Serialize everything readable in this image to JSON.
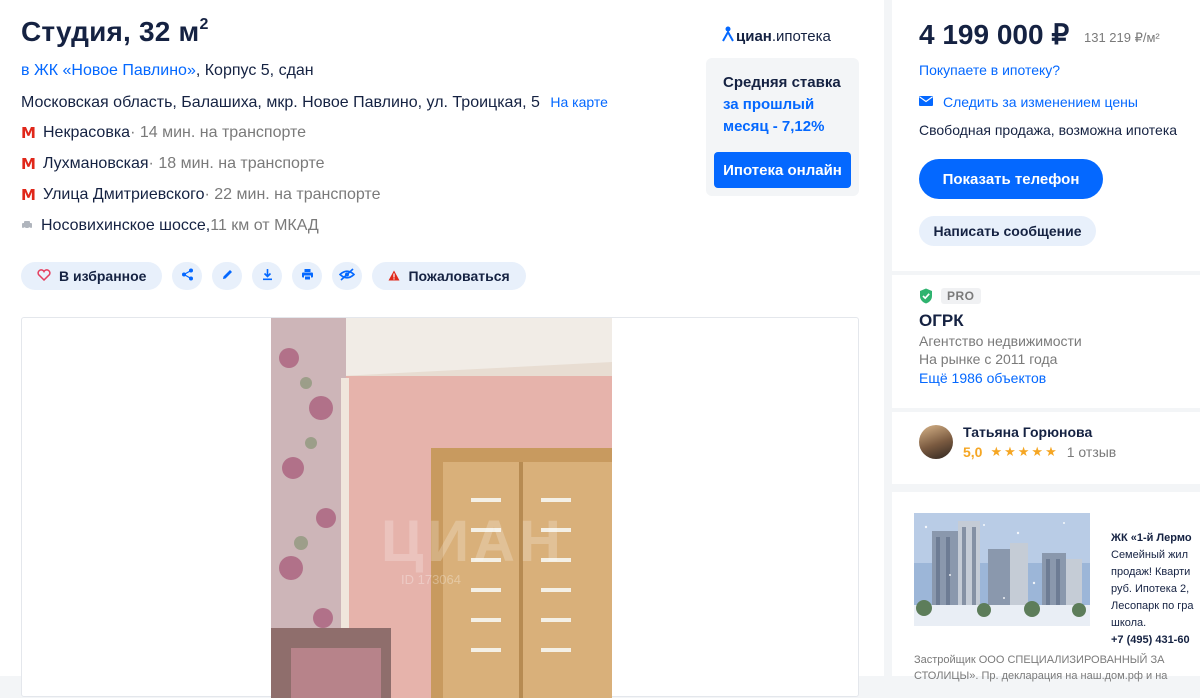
{
  "listing": {
    "title": "Студия, 32 м",
    "title_sup": "2",
    "complex_link": "в ЖК «Новое Павлино»",
    "complex_rest": ", Корпус 5, сдан",
    "address": "Московская область, Балашиха, мкр. Новое Павлино, ул. Троицкая, 5",
    "map_link": "На карте",
    "metro": [
      {
        "name": "Некрасовка",
        "time": " · 14 мин. на транспорте"
      },
      {
        "name": "Лухмановская",
        "time": " · 18 мин. на транспорте"
      },
      {
        "name": "Улица Дмитриевского",
        "time": " · 22 мин. на транспорте"
      }
    ],
    "highway": {
      "name": "Носовихинское шоссе,",
      "distance": " 11 км от МКАД"
    }
  },
  "actions": {
    "favorite": "В избранное",
    "complain": "Пожаловаться"
  },
  "mortgage": {
    "logo_main": "циан",
    "logo_sub": ".ипотека",
    "rate_line1": "Средняя ставка",
    "rate_line2": "за прошлый",
    "rate_line3": "месяц - 7,12%",
    "button": "Ипотека онлайн"
  },
  "photo": {
    "watermark": "ЦИАН",
    "watermark_id": "ID 173064"
  },
  "sidebar": {
    "price": "4 199 000 ₽",
    "price_per_m2": "131 219 ₽/м²",
    "mortgage_link": "Покупаете в ипотеку?",
    "track_price": "Следить за изменением цены",
    "sale_type": "Свободная продажа, возможна ипотека",
    "show_phone": "Показать телефон",
    "write_message": "Написать сообщение"
  },
  "agency": {
    "badge": "PRO",
    "name": "ОГРК",
    "type": "Агентство недвижимости",
    "since": "На рынке с 2011 года",
    "more_objects": "Ещё 1986 объектов"
  },
  "agent": {
    "name": "Татьяна Горюнова",
    "score": "5,0",
    "stars": "★★★★★",
    "reviews": "1 отзыв"
  },
  "ad": {
    "title": "ЖК «1-й Лермо",
    "lines": [
      "Семейный жил",
      "продаж! Кварти",
      "руб. Ипотека 2,",
      "Лесопарк по гра",
      "школа."
    ],
    "phone": "+7 (495) 431-60",
    "footer1": "Застройщик ООО СПЕЦИАЛИЗИРОВАННЫЙ ЗА",
    "footer2": "СТОЛИЦЫ». Пр. декларация на наш.дом.рф и на"
  },
  "colors": {
    "accent": "#0468ff",
    "text": "#152242",
    "metro": "#e0271a",
    "star": "#f5a623",
    "pro_check": "#2eb36f"
  }
}
